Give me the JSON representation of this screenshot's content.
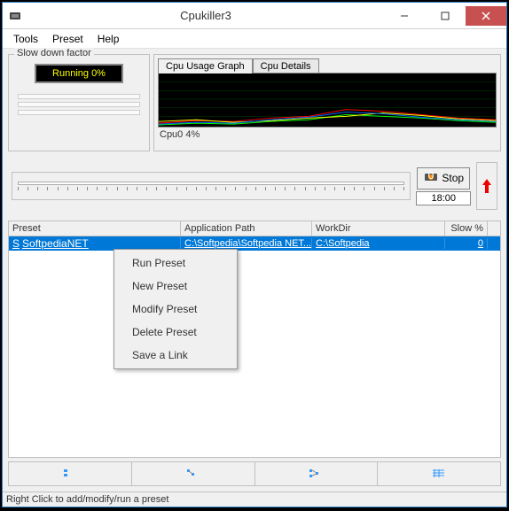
{
  "window": {
    "title": "Cpukiller3"
  },
  "menubar": {
    "tools": "Tools",
    "preset": "Preset",
    "help": "Help"
  },
  "slowdown": {
    "group_title": "Slow down factor",
    "running_badge": "Running 0%"
  },
  "graph": {
    "tab_usage": "Cpu Usage Graph",
    "tab_details": "Cpu Details",
    "label": "Cpu0 4%"
  },
  "controls": {
    "stop": "Stop",
    "time": "18:00"
  },
  "grid": {
    "headers": {
      "preset": "Preset",
      "path": "Application Path",
      "workdir": "WorkDir",
      "slow": "Slow %"
    },
    "rows": [
      {
        "preset": "SoftpediaNET",
        "path": "C:\\Softpedia\\Softpedia NET...",
        "workdir": "C:\\Softpedia",
        "slow": "0"
      }
    ]
  },
  "context_menu": {
    "run": "Run Preset",
    "new": "New Preset",
    "modify": "Modify Preset",
    "delete": "Delete Preset",
    "save_link": "Save a Link"
  },
  "statusbar": {
    "text": "Right Click to add/modify/run a preset"
  }
}
